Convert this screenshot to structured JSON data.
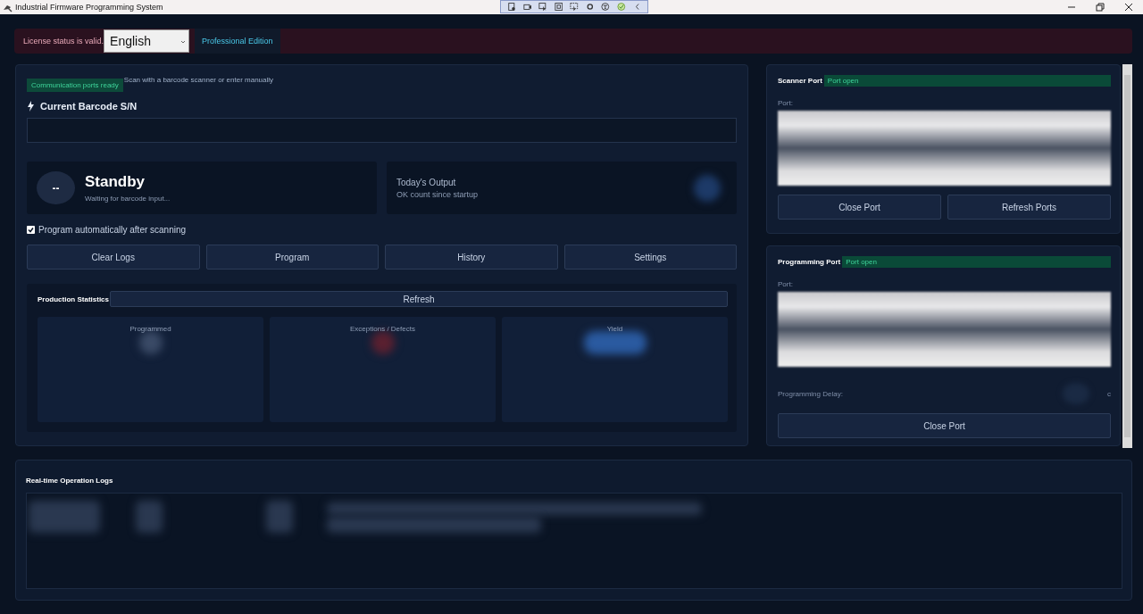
{
  "window": {
    "title": "Industrial Firmware Programming System"
  },
  "license_bar": {
    "status": "License status is valid.",
    "language": "English",
    "edition": "Professional Edition"
  },
  "scan_panel": {
    "ports_badge": "Communication ports ready",
    "hint": "Scan with a barcode scanner or enter manually",
    "barcode_label": "Current Barcode S/N",
    "status_mark": "--",
    "status_title": "Standby",
    "status_subtitle": "Waiting for barcode input...",
    "output_title": "Today's Output",
    "output_subtitle": "OK count since startup",
    "auto_program": {
      "label": "Program automatically after scanning",
      "checked": true
    },
    "buttons": [
      "Clear Logs",
      "Program",
      "History",
      "Settings"
    ]
  },
  "statistics": {
    "title": "Production Statistics",
    "refresh": "Refresh",
    "cards": [
      {
        "label": "Programmed",
        "color": "#3a4a66"
      },
      {
        "label": "Exceptions / Defects",
        "color": "#5a2030"
      },
      {
        "label": "Yield",
        "color": "#2a5aa0"
      }
    ]
  },
  "scanner_port": {
    "title": "Scanner Port",
    "status": "Port open",
    "port_label": "Port:",
    "buttons": [
      "Close Port",
      "Refresh Ports"
    ]
  },
  "programming_port": {
    "title": "Programming Port",
    "status": "Port open",
    "port_label": "Port:",
    "delay_label": "Programming Delay:",
    "delay_unit": "c",
    "buttons": [
      "Close Port"
    ]
  },
  "logs": {
    "title": "Real-time Operation Logs"
  }
}
